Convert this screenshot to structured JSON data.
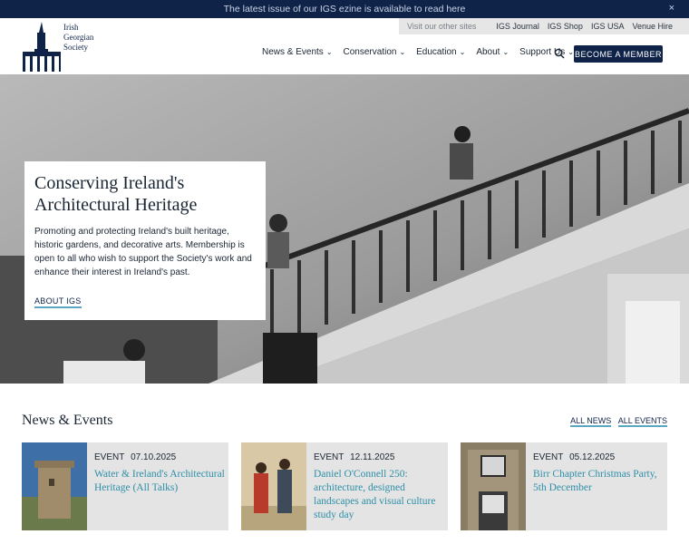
{
  "announcement": {
    "text": "The latest issue of our IGS ezine is available to read here",
    "close": "×"
  },
  "other_sites": {
    "label": "Visit our other sites",
    "links": [
      "IGS Journal",
      "IGS Shop",
      "IGS USA",
      "Venue Hire"
    ]
  },
  "logo": {
    "lines": [
      "Irish",
      "Georgian",
      "Society"
    ]
  },
  "nav": {
    "items": [
      "News & Events",
      "Conservation",
      "Education",
      "About",
      "Support Us"
    ],
    "search_icon": "search-icon",
    "member_button": "BECOME A MEMBER"
  },
  "hero": {
    "title": "Conserving Ireland's Architectural Heritage",
    "text": "Promoting and protecting Ireland's built heritage, historic gardens, and decorative arts. Membership is open to all who wish to support the Society's work and enhance their interest in Ireland's past.",
    "link": "ABOUT IGS"
  },
  "news": {
    "title": "News & Events",
    "all_news": "ALL NEWS",
    "all_events": "ALL EVENTS",
    "cards": [
      {
        "type": "EVENT",
        "date": "07.10.2025",
        "title": "Water & Ireland's Architectural Heritage (All Talks)"
      },
      {
        "type": "EVENT",
        "date": "12.11.2025",
        "title": "Daniel O'Connell 250: architecture, designed landscapes and visual culture study day"
      },
      {
        "type": "EVENT",
        "date": "05.12.2025",
        "title": "Birr Chapter Christmas Party, 5th December"
      }
    ]
  },
  "colors": {
    "navy": "#0f2349",
    "accent": "#2e8fa8",
    "underline": "#5aa7c2"
  }
}
